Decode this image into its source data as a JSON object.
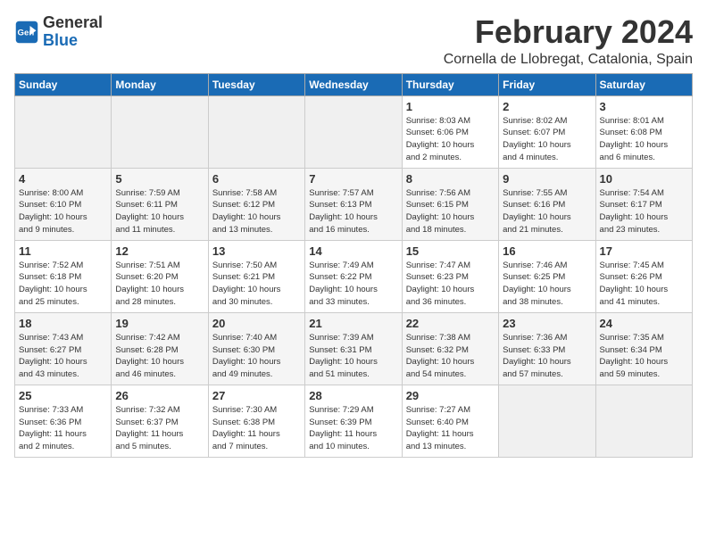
{
  "logo": {
    "text_general": "General",
    "text_blue": "Blue"
  },
  "title": "February 2024",
  "location": "Cornella de Llobregat, Catalonia, Spain",
  "weekdays": [
    "Sunday",
    "Monday",
    "Tuesday",
    "Wednesday",
    "Thursday",
    "Friday",
    "Saturday"
  ],
  "weeks": [
    [
      {
        "day": "",
        "info": ""
      },
      {
        "day": "",
        "info": ""
      },
      {
        "day": "",
        "info": ""
      },
      {
        "day": "",
        "info": ""
      },
      {
        "day": "1",
        "info": "Sunrise: 8:03 AM\nSunset: 6:06 PM\nDaylight: 10 hours\nand 2 minutes."
      },
      {
        "day": "2",
        "info": "Sunrise: 8:02 AM\nSunset: 6:07 PM\nDaylight: 10 hours\nand 4 minutes."
      },
      {
        "day": "3",
        "info": "Sunrise: 8:01 AM\nSunset: 6:08 PM\nDaylight: 10 hours\nand 6 minutes."
      }
    ],
    [
      {
        "day": "4",
        "info": "Sunrise: 8:00 AM\nSunset: 6:10 PM\nDaylight: 10 hours\nand 9 minutes."
      },
      {
        "day": "5",
        "info": "Sunrise: 7:59 AM\nSunset: 6:11 PM\nDaylight: 10 hours\nand 11 minutes."
      },
      {
        "day": "6",
        "info": "Sunrise: 7:58 AM\nSunset: 6:12 PM\nDaylight: 10 hours\nand 13 minutes."
      },
      {
        "day": "7",
        "info": "Sunrise: 7:57 AM\nSunset: 6:13 PM\nDaylight: 10 hours\nand 16 minutes."
      },
      {
        "day": "8",
        "info": "Sunrise: 7:56 AM\nSunset: 6:15 PM\nDaylight: 10 hours\nand 18 minutes."
      },
      {
        "day": "9",
        "info": "Sunrise: 7:55 AM\nSunset: 6:16 PM\nDaylight: 10 hours\nand 21 minutes."
      },
      {
        "day": "10",
        "info": "Sunrise: 7:54 AM\nSunset: 6:17 PM\nDaylight: 10 hours\nand 23 minutes."
      }
    ],
    [
      {
        "day": "11",
        "info": "Sunrise: 7:52 AM\nSunset: 6:18 PM\nDaylight: 10 hours\nand 25 minutes."
      },
      {
        "day": "12",
        "info": "Sunrise: 7:51 AM\nSunset: 6:20 PM\nDaylight: 10 hours\nand 28 minutes."
      },
      {
        "day": "13",
        "info": "Sunrise: 7:50 AM\nSunset: 6:21 PM\nDaylight: 10 hours\nand 30 minutes."
      },
      {
        "day": "14",
        "info": "Sunrise: 7:49 AM\nSunset: 6:22 PM\nDaylight: 10 hours\nand 33 minutes."
      },
      {
        "day": "15",
        "info": "Sunrise: 7:47 AM\nSunset: 6:23 PM\nDaylight: 10 hours\nand 36 minutes."
      },
      {
        "day": "16",
        "info": "Sunrise: 7:46 AM\nSunset: 6:25 PM\nDaylight: 10 hours\nand 38 minutes."
      },
      {
        "day": "17",
        "info": "Sunrise: 7:45 AM\nSunset: 6:26 PM\nDaylight: 10 hours\nand 41 minutes."
      }
    ],
    [
      {
        "day": "18",
        "info": "Sunrise: 7:43 AM\nSunset: 6:27 PM\nDaylight: 10 hours\nand 43 minutes."
      },
      {
        "day": "19",
        "info": "Sunrise: 7:42 AM\nSunset: 6:28 PM\nDaylight: 10 hours\nand 46 minutes."
      },
      {
        "day": "20",
        "info": "Sunrise: 7:40 AM\nSunset: 6:30 PM\nDaylight: 10 hours\nand 49 minutes."
      },
      {
        "day": "21",
        "info": "Sunrise: 7:39 AM\nSunset: 6:31 PM\nDaylight: 10 hours\nand 51 minutes."
      },
      {
        "day": "22",
        "info": "Sunrise: 7:38 AM\nSunset: 6:32 PM\nDaylight: 10 hours\nand 54 minutes."
      },
      {
        "day": "23",
        "info": "Sunrise: 7:36 AM\nSunset: 6:33 PM\nDaylight: 10 hours\nand 57 minutes."
      },
      {
        "day": "24",
        "info": "Sunrise: 7:35 AM\nSunset: 6:34 PM\nDaylight: 10 hours\nand 59 minutes."
      }
    ],
    [
      {
        "day": "25",
        "info": "Sunrise: 7:33 AM\nSunset: 6:36 PM\nDaylight: 11 hours\nand 2 minutes."
      },
      {
        "day": "26",
        "info": "Sunrise: 7:32 AM\nSunset: 6:37 PM\nDaylight: 11 hours\nand 5 minutes."
      },
      {
        "day": "27",
        "info": "Sunrise: 7:30 AM\nSunset: 6:38 PM\nDaylight: 11 hours\nand 7 minutes."
      },
      {
        "day": "28",
        "info": "Sunrise: 7:29 AM\nSunset: 6:39 PM\nDaylight: 11 hours\nand 10 minutes."
      },
      {
        "day": "29",
        "info": "Sunrise: 7:27 AM\nSunset: 6:40 PM\nDaylight: 11 hours\nand 13 minutes."
      },
      {
        "day": "",
        "info": ""
      },
      {
        "day": "",
        "info": ""
      }
    ]
  ]
}
